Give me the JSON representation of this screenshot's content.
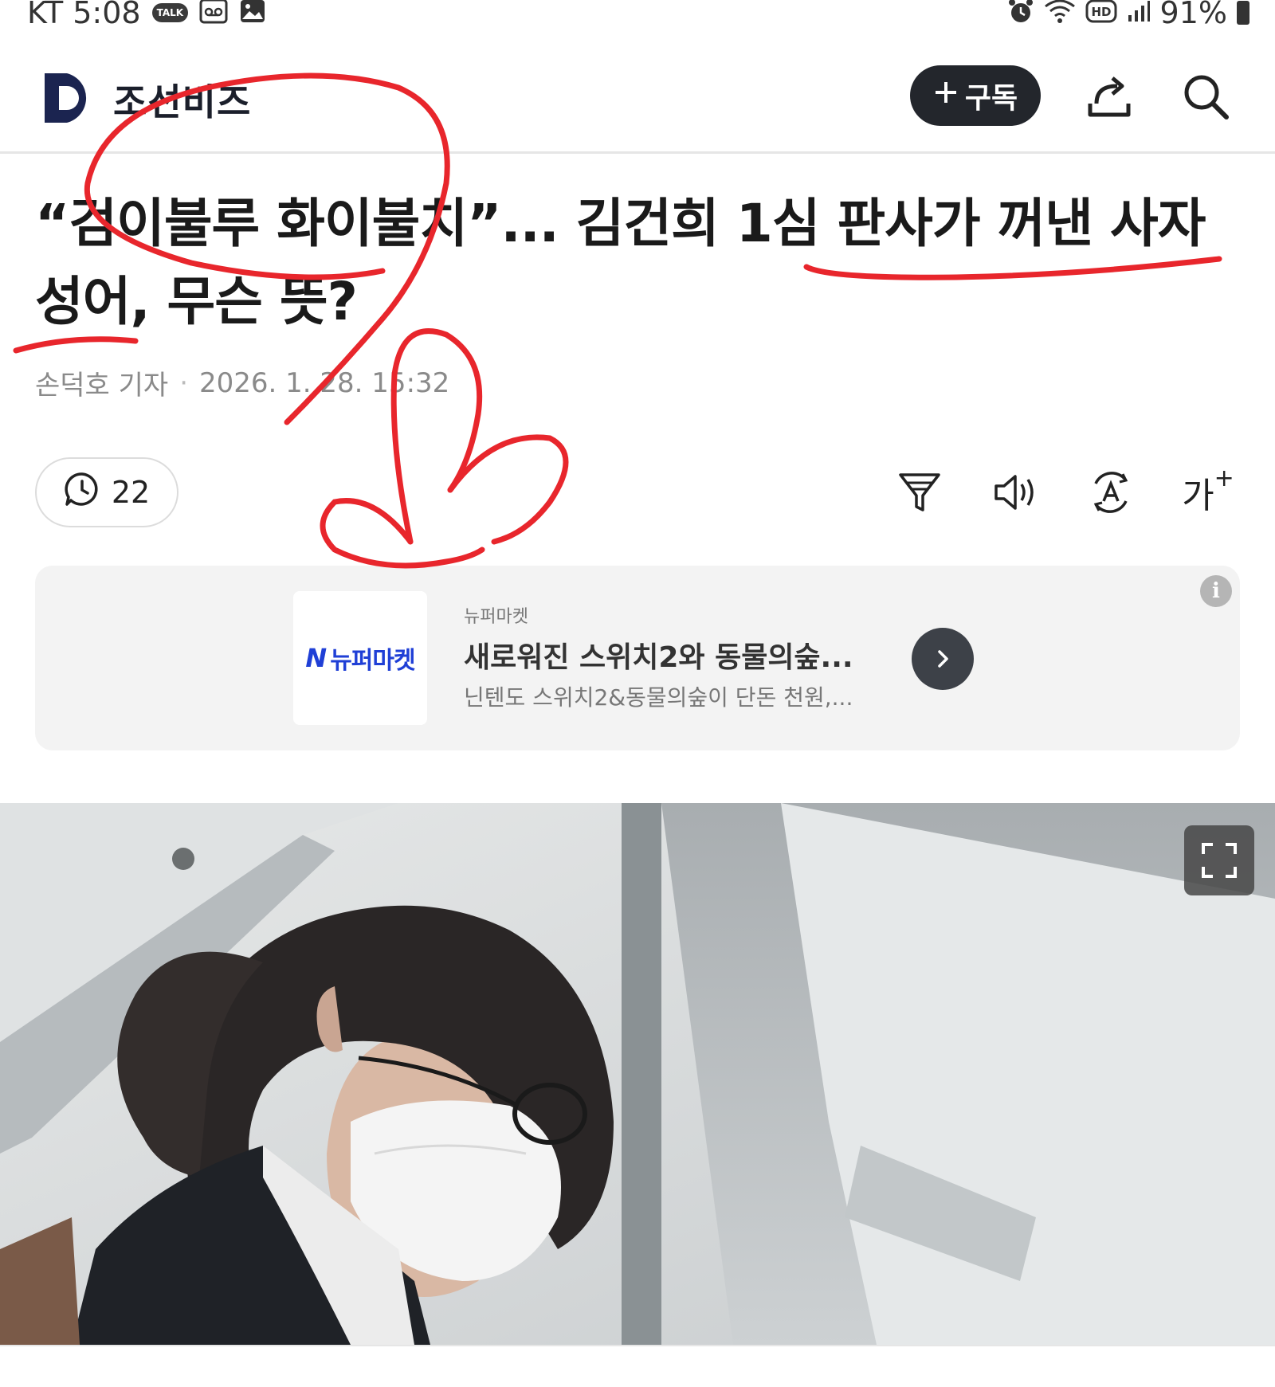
{
  "status_bar": {
    "carrier_time": "KT 5:08",
    "talk_badge": "TALK",
    "battery": "91%"
  },
  "app_bar": {
    "logo_letter": "D",
    "logo_text": "조선비즈",
    "subscribe_label": "구독"
  },
  "article": {
    "headline": "“검이불루 화이불치”... 김건희 1심 판사가 꺼낸 사자성어, 무슨 뜻?",
    "author": "손덕호 기자",
    "date": "2026. 1. 28. 15:32"
  },
  "toolbar": {
    "comment_count": "22",
    "font_size_label": "가"
  },
  "ad": {
    "logo_text": "뉴퍼마켓",
    "brand": "뉴퍼마켓",
    "title": "새로워진 스위치2와 동물의숲...",
    "description": "닌텐도 스위치2&동물의숲이 단돈 천원,..."
  },
  "colors": {
    "accent_dark": "#23262c",
    "logo_navy": "#1b2450",
    "ad_blue": "#1f3fd6",
    "annotation_red": "#e8262c"
  }
}
